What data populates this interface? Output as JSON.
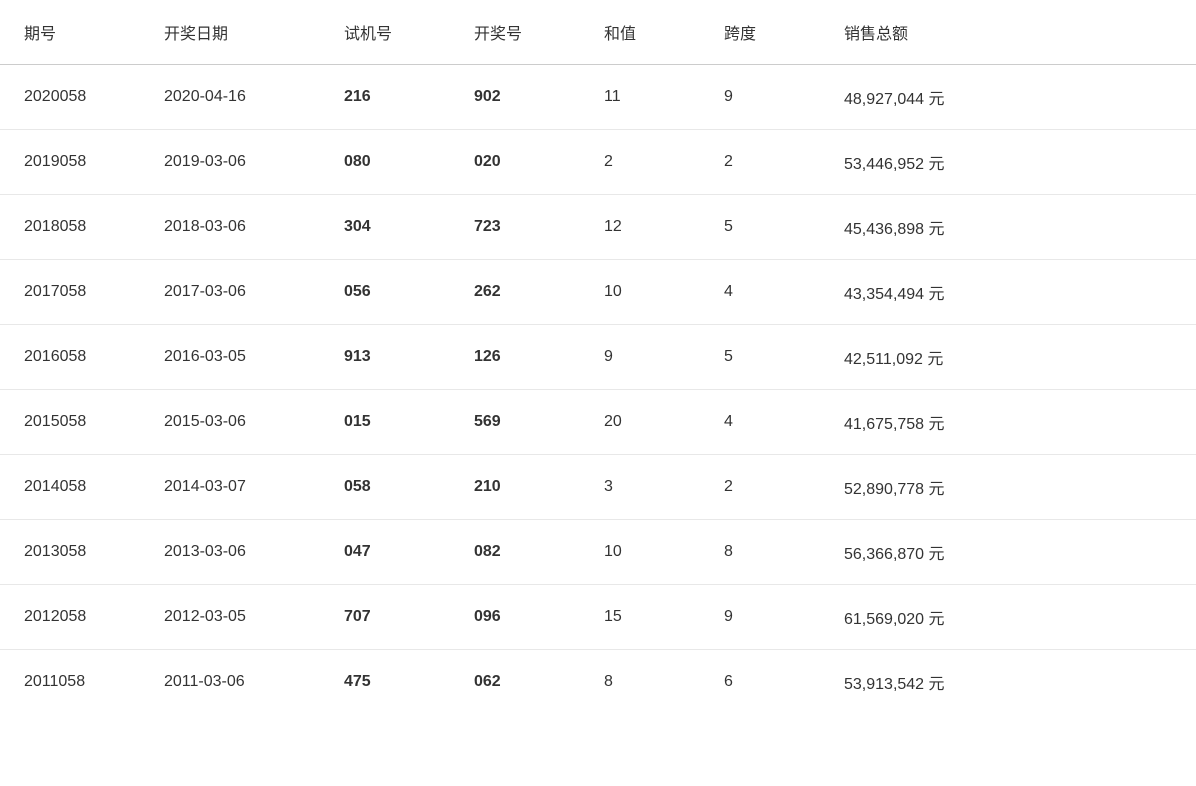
{
  "table": {
    "headers": [
      "期号",
      "开奖日期",
      "试机号",
      "开奖号",
      "和值",
      "跨度",
      "销售总额"
    ],
    "rows": [
      {
        "period": "2020058",
        "date": "2020-04-16",
        "trial": "216",
        "winning": "902",
        "sum": "11",
        "span": "9",
        "sales": "48,927,044 元"
      },
      {
        "period": "2019058",
        "date": "2019-03-06",
        "trial": "080",
        "winning": "020",
        "sum": "2",
        "span": "2",
        "sales": "53,446,952 元"
      },
      {
        "period": "2018058",
        "date": "2018-03-06",
        "trial": "304",
        "winning": "723",
        "sum": "12",
        "span": "5",
        "sales": "45,436,898 元"
      },
      {
        "period": "2017058",
        "date": "2017-03-06",
        "trial": "056",
        "winning": "262",
        "sum": "10",
        "span": "4",
        "sales": "43,354,494 元"
      },
      {
        "period": "2016058",
        "date": "2016-03-05",
        "trial": "913",
        "winning": "126",
        "sum": "9",
        "span": "5",
        "sales": "42,511,092 元"
      },
      {
        "period": "2015058",
        "date": "2015-03-06",
        "trial": "015",
        "winning": "569",
        "sum": "20",
        "span": "4",
        "sales": "41,675,758 元"
      },
      {
        "period": "2014058",
        "date": "2014-03-07",
        "trial": "058",
        "winning": "210",
        "sum": "3",
        "span": "2",
        "sales": "52,890,778 元"
      },
      {
        "period": "2013058",
        "date": "2013-03-06",
        "trial": "047",
        "winning": "082",
        "sum": "10",
        "span": "8",
        "sales": "56,366,870 元"
      },
      {
        "period": "2012058",
        "date": "2012-03-05",
        "trial": "707",
        "winning": "096",
        "sum": "15",
        "span": "9",
        "sales": "61,569,020 元"
      },
      {
        "period": "2011058",
        "date": "2011-03-06",
        "trial": "475",
        "winning": "062",
        "sum": "8",
        "span": "6",
        "sales": "53,913,542 元"
      }
    ]
  }
}
